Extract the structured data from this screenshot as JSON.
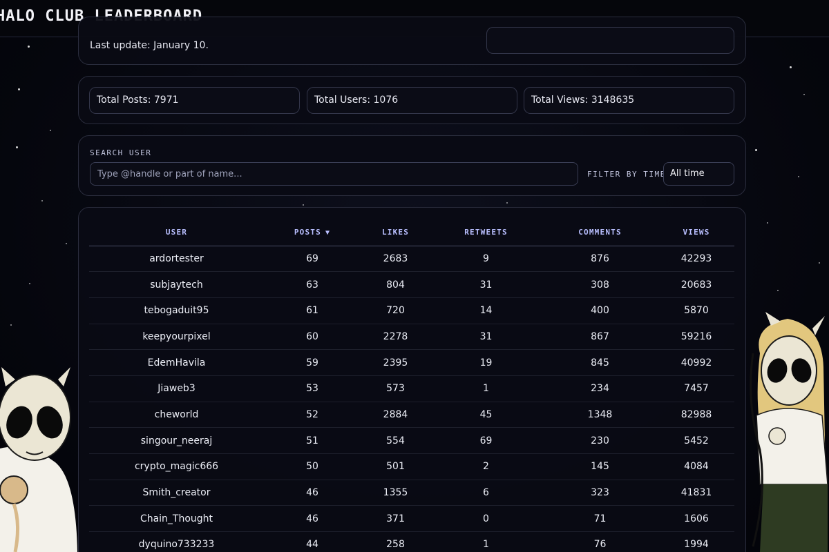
{
  "app": {
    "title": "HALO CLUB LEADERBOARD"
  },
  "header": {
    "last_update": "Last update: January 10."
  },
  "stats": {
    "total_posts": "Total Posts: 7971",
    "total_users": "Total Users: 1076",
    "total_views": "Total Views: 3148635"
  },
  "search": {
    "label": "SEARCH USER",
    "placeholder": "Type @handle or part of name...",
    "filter_label": "FILTER BY TIME:",
    "filter_value": "All time"
  },
  "table": {
    "columns": [
      "USER",
      "POSTS",
      "LIKES",
      "RETWEETS",
      "COMMENTS",
      "VIEWS"
    ],
    "sort_icon": "sort-desc-icon",
    "rows": [
      [
        "ardortester",
        "69",
        "2683",
        "9",
        "876",
        "42293"
      ],
      [
        "subjaytech",
        "63",
        "804",
        "31",
        "308",
        "20683"
      ],
      [
        "tebogaduit95",
        "61",
        "720",
        "14",
        "400",
        "5870"
      ],
      [
        "keepyourpixel",
        "60",
        "2278",
        "31",
        "867",
        "59216"
      ],
      [
        "EdemHavila",
        "59",
        "2395",
        "19",
        "845",
        "40992"
      ],
      [
        "Jiaweb3",
        "53",
        "573",
        "1",
        "234",
        "7457"
      ],
      [
        "cheworld",
        "52",
        "2884",
        "45",
        "1348",
        "82988"
      ],
      [
        "singour_neeraj",
        "51",
        "554",
        "69",
        "230",
        "5452"
      ],
      [
        "crypto_magic666",
        "50",
        "501",
        "2",
        "145",
        "4084"
      ],
      [
        "Smith_creator",
        "46",
        "1355",
        "6",
        "323",
        "41831"
      ],
      [
        "Chain_Thought",
        "46",
        "371",
        "0",
        "71",
        "1606"
      ],
      [
        "dyquino733233",
        "44",
        "258",
        "1",
        "76",
        "1994"
      ]
    ]
  },
  "colors": {
    "accent": "#b9bfff",
    "background": "#05060d",
    "panel": "#0a0b14"
  }
}
